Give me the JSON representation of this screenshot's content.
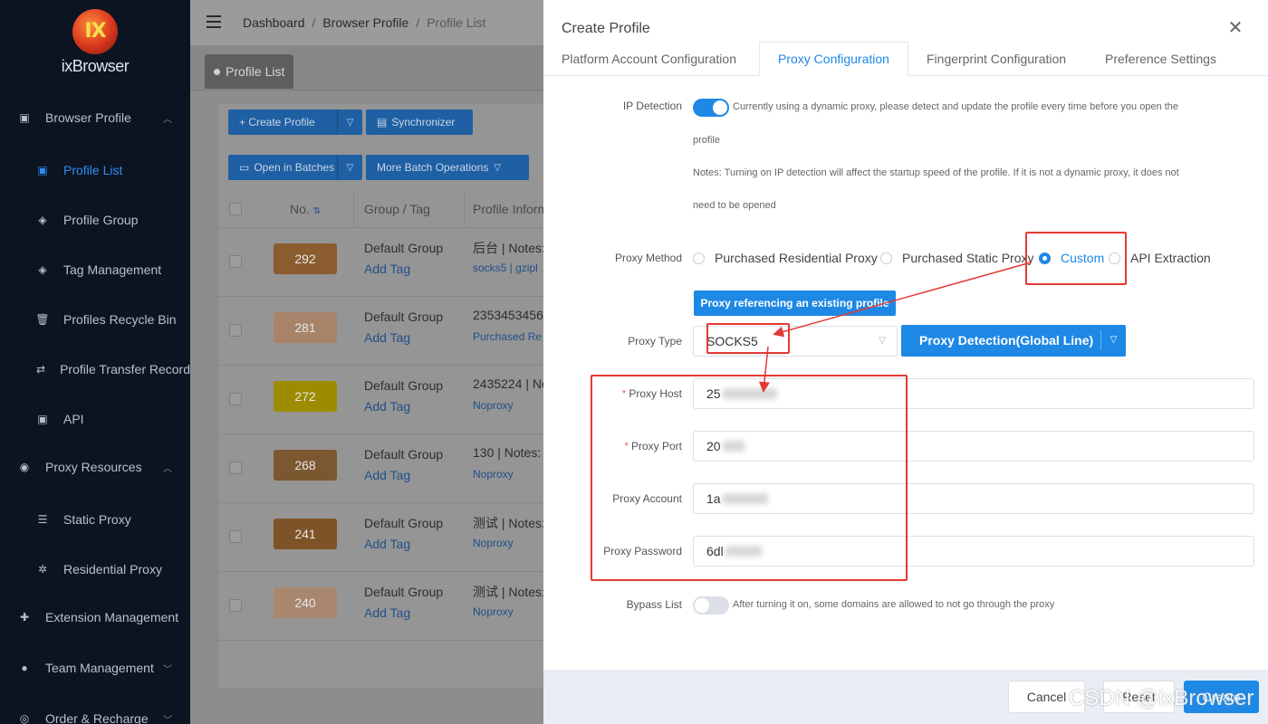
{
  "sidebar": {
    "logo_text": "ixBrowser",
    "items": [
      {
        "label": "Browser Profile",
        "icon": "calendar-icon"
      },
      {
        "label": "Profile List",
        "icon": "calendar-icon"
      },
      {
        "label": "Profile Group",
        "icon": "layers-icon"
      },
      {
        "label": "Tag Management",
        "icon": "layers-icon"
      },
      {
        "label": "Profiles Recycle Bin",
        "icon": "trash-icon"
      },
      {
        "label": "Profile Transfer Record",
        "icon": "transfer-icon"
      },
      {
        "label": "API",
        "icon": "calendar-icon"
      },
      {
        "label": "Proxy Resources",
        "icon": "globe-icon"
      },
      {
        "label": "Static Proxy",
        "icon": "list-icon"
      },
      {
        "label": "Residential Proxy",
        "icon": "network-icon"
      },
      {
        "label": "Extension Management",
        "icon": "puzzle-icon"
      },
      {
        "label": "Team Management",
        "icon": "user-icon"
      },
      {
        "label": "Order & Recharge",
        "icon": "coin-icon"
      }
    ]
  },
  "breadcrumb": {
    "home": "Dashboard",
    "section": "Browser Profile",
    "current": "Profile List"
  },
  "tab": {
    "label": "Profile List"
  },
  "toolbar": {
    "create": "+ Create Profile",
    "sync": "Synchronizer",
    "open_batches": "Open in Batches",
    "more_batch": "More Batch Operations"
  },
  "table": {
    "headers": {
      "no": "No.",
      "group": "Group / Tag",
      "info": "Profile Informe"
    },
    "rows": [
      {
        "no": "292",
        "group": "Default Group",
        "tag": "Add Tag",
        "info": "后台 | Notes:",
        "proxy": "socks5 | gzipl",
        "color": "#8a5c2e"
      },
      {
        "no": "281",
        "group": "Default Group",
        "tag": "Add Tag",
        "info": "2353453456",
        "proxy": "Purchased Re",
        "color": "#a8836a"
      },
      {
        "no": "272",
        "group": "Default Group",
        "tag": "Add Tag",
        "info": "2435224 | No",
        "proxy": "Noproxy",
        "color": "#9e8c00"
      },
      {
        "no": "268",
        "group": "Default Group",
        "tag": "Add Tag",
        "info": "130 | Notes:",
        "proxy": "Noproxy",
        "color": "#7c5830"
      },
      {
        "no": "241",
        "group": "Default Group",
        "tag": "Add Tag",
        "info": "测试 | Notes:",
        "proxy": "Noproxy",
        "color": "#7f5328"
      },
      {
        "no": "240",
        "group": "Default Group",
        "tag": "Add Tag",
        "info": "测试 | Notes:",
        "proxy": "Noproxy",
        "color": "#a9876e"
      }
    ]
  },
  "modal": {
    "title": "Create Profile",
    "tabs": [
      "Platform Account Configuration",
      "Proxy Configuration",
      "Fingerprint Configuration",
      "Preference Settings"
    ],
    "ip_detection": {
      "label": "IP Detection",
      "text1": "Currently using a dynamic proxy, please detect and update the profile every time before you open the",
      "text2": "profile",
      "text3": "Notes: Turning on IP detection will affect the startup speed of the profile. If it is not a dynamic proxy, it does not",
      "text4": "need to be opened"
    },
    "proxy_method": {
      "label": "Proxy Method",
      "options": [
        "Purchased Residential Proxy",
        "Purchased Static Proxy",
        "Custom",
        "API Extraction"
      ],
      "selected": "Custom"
    },
    "reference_btn": "Proxy referencing an existing profile",
    "proxy_type": {
      "label": "Proxy Type",
      "value": "SOCKS5",
      "detect_btn": "Proxy Detection(Global Line)"
    },
    "host": {
      "label": "Proxy Host",
      "value": "25"
    },
    "port": {
      "label": "Proxy Port",
      "value": "20"
    },
    "account": {
      "label": "Proxy Account",
      "value": "1a"
    },
    "password": {
      "label": "Proxy Password",
      "value": "6dl"
    },
    "bypass": {
      "label": "Bypass List",
      "text": "After turning it on, some domains are allowed to not go through the proxy"
    }
  },
  "footer": {
    "cancel": "Cancel",
    "reset": "Reset",
    "create": "Create"
  },
  "watermark": "CSDN @ixBrowser",
  "colors": {
    "accent": "#1e88e5",
    "highlight": "#e53935",
    "sidebar_bg": "#0c1422"
  }
}
